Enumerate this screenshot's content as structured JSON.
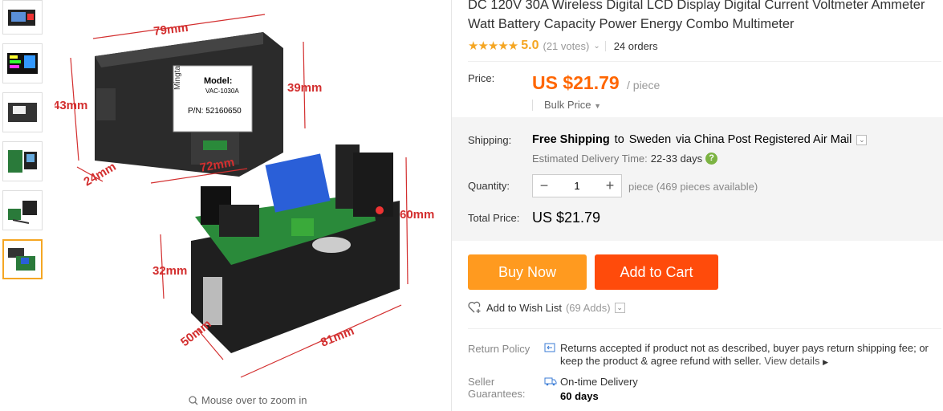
{
  "product": {
    "title": "DC 120V 30A Wireless Digital LCD Display Digital Current Voltmeter Ammeter Watt Battery Capacity Power Energy Combo Multimeter",
    "rating_stars": "★★★★★",
    "rating_value": "5.0",
    "votes": "(21 votes)",
    "orders": "24 orders"
  },
  "image": {
    "zoom_hint": "Mouse over to zoom in",
    "dims": {
      "w79": "79mm",
      "h39": "39mm",
      "h43": "43mm",
      "d24": "24mm",
      "l72": "72mm",
      "h60": "60mm",
      "h32": "32mm",
      "d50": "50mm",
      "l81": "81mm"
    },
    "label_model": "Model:",
    "label_model_no": "VAC-1030A",
    "label_pn": "P/N: 52160650",
    "label_brand": "Mingtai"
  },
  "thumbnails": [
    {
      "icon": "meter-photo-1"
    },
    {
      "icon": "lcd-display-photo"
    },
    {
      "icon": "meter-side-photo"
    },
    {
      "icon": "board-photo"
    },
    {
      "icon": "kit-photo"
    },
    {
      "icon": "relay-box-photo",
      "active": true
    }
  ],
  "price": {
    "label": "Price:",
    "value": "US $21.79",
    "unit": "/ piece",
    "bulk": "Bulk Price"
  },
  "shipping": {
    "label": "Shipping:",
    "prefix": "Free Shipping",
    "to": "to",
    "country": "Sweden",
    "via": "via China Post Registered Air Mail",
    "eta_label": "Estimated Delivery Time:",
    "eta_days": "22-33 days"
  },
  "quantity": {
    "label": "Quantity:",
    "value": "1",
    "note": "piece (469 pieces available)"
  },
  "total": {
    "label": "Total Price:",
    "value": "US $21.79"
  },
  "actions": {
    "buy_now": "Buy Now",
    "add_to_cart": "Add to Cart",
    "wishlist": "Add to Wish List",
    "wishlist_count": "(69 Adds)"
  },
  "policy": {
    "return_label": "Return Policy",
    "return_text": "Returns accepted if product not as described, buyer pays return shipping fee; or keep the product & agree refund with seller.",
    "view_details": "View details",
    "seller_label": "Seller Guarantees:",
    "seller_text": "On-time Delivery",
    "seller_days": "60 days"
  },
  "colors": {
    "price": "#ff6600",
    "buy_now": "#ff9a1f",
    "add_to_cart": "#ff4b0b",
    "stars": "#f5a623",
    "dimension_lines": "#d32f2f"
  }
}
